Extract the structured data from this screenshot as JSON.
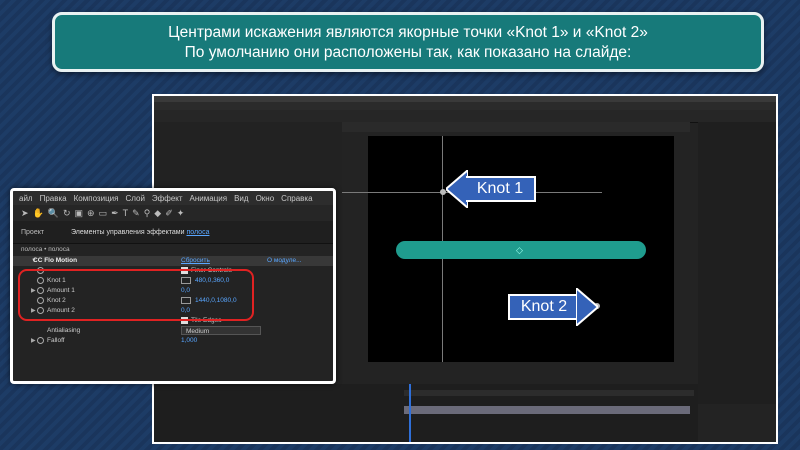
{
  "banner": {
    "line1": "Центрами искажения являются якорные точки «Knot 1» и «Knot 2»",
    "line2": "По умолчанию они расположены так, как показано на слайде:"
  },
  "arrows": {
    "knot1": "Knot 1",
    "knot2": "Knot 2"
  },
  "inset": {
    "menu": [
      "айл",
      "Правка",
      "Композиция",
      "Слой",
      "Эффект",
      "Анимация",
      "Вид",
      "Окно",
      "Справка"
    ],
    "tab_project": "Проект",
    "tab_fx_prefix": "Элементы управления эффектами",
    "tab_fx_link": "полоса",
    "breadcrumb": "полоса • полоса",
    "effect_name": "CC Flo Motion",
    "reset": "Сбросить",
    "about": "О модуле...",
    "props": {
      "finer": "Finer Controls",
      "knot1": "Knot 1",
      "knot1_val": "480,0,360,0",
      "amount1": "Amount 1",
      "amount1_val": "0,0",
      "knot2": "Knot 2",
      "knot2_val": "1440,0,1080,0",
      "amount2": "Amount 2",
      "amount2_val": "0,0",
      "tile": "Tile Edges",
      "antialiasing": "Antialiasing",
      "antialiasing_val": "Medium",
      "falloff": "Falloff",
      "falloff_val": "1,000"
    }
  },
  "colors": {
    "banner": "#177a7a",
    "highlight": "#e02222",
    "arrow": "#3462b8",
    "bar": "#1f9c8e"
  }
}
